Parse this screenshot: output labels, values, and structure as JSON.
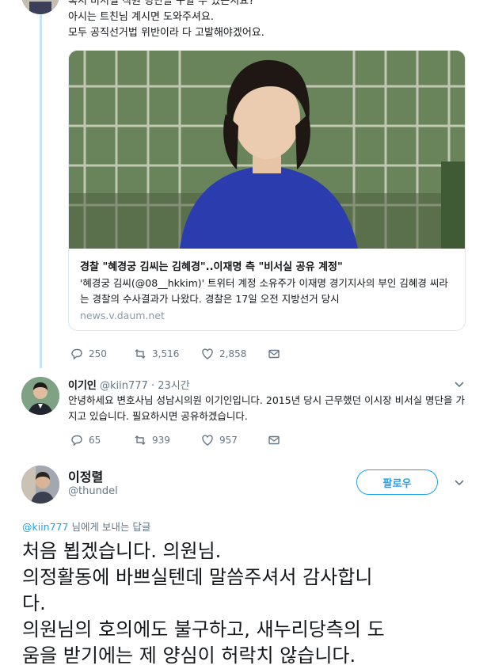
{
  "tweet1": {
    "lines": [
      "혹시 비서실 직원 명단을 구할 수 있는지요?",
      "아시는 트친님 계시면 도와주셔요.",
      "모두 공직선거법 위반이라 다 고발해야겠어요."
    ],
    "card": {
      "title": "경찰 \"혜경궁 김씨는 김혜경\"..이재명 측 \"비서실 공유 계정\"",
      "desc": "'혜경궁 김씨(@08__hkkim)' 트위터 계정 소유주가 이재명 경기지사의 부인 김혜경 씨라는 경찰의 수사결과가 나왔다. 경찰은 17일 오전 지방선거 당시",
      "url": "news.v.daum.net"
    },
    "stats": {
      "replies": "250",
      "retweets": "3,516",
      "likes": "2,858"
    }
  },
  "tweet2": {
    "name": "이기인",
    "handle": "@kiin777 · 23시간",
    "body": "안녕하세요 변호사님 성남시의원 이기인입니다. 2015년 당시 근무했던 이시장 비서실 명단을 가지고 있습니다. 필요하시면 공유하겠습니다.",
    "stats": {
      "replies": "65",
      "retweets": "939",
      "likes": "957"
    }
  },
  "tweet3": {
    "name": "이정렬",
    "handle": "@thundel",
    "follow_label": "팔로우",
    "reply_mention": "@kiin777",
    "reply_suffix": " 님에게 보내는 답글",
    "lines": [
      "처음 뵙겠습니다. 의원님.",
      "의정활동에 바쁘실텐데 말씀주셔서 감사합니",
      "다.",
      "의원님의 호의에도 불구하고, 새누리당측의 도",
      "움을 받기에는 제 양심이 허락치 않습니다."
    ]
  },
  "colors": {
    "accent": "#1da1f2",
    "muted": "#657786",
    "thread": "#c4e5f9"
  }
}
